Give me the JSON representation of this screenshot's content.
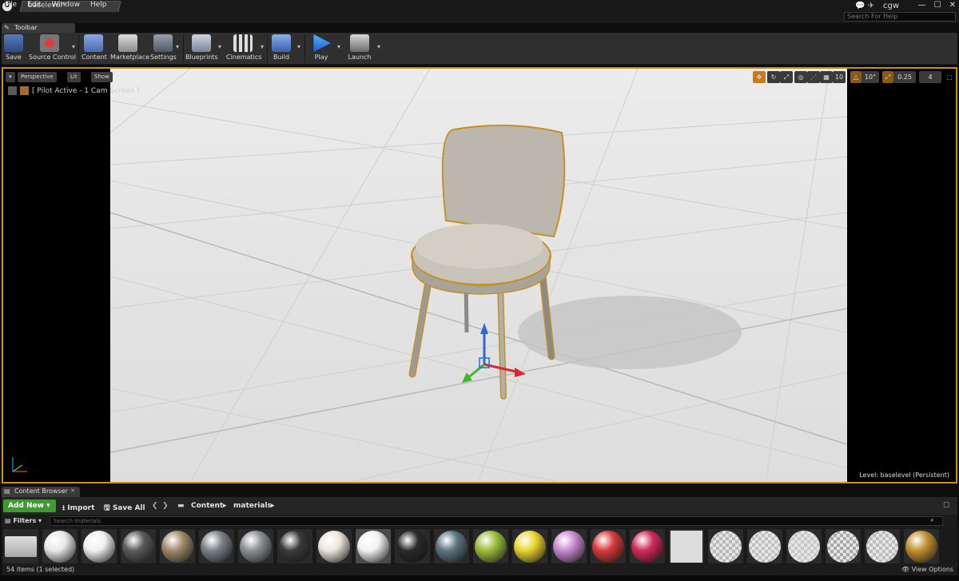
{
  "window": {
    "document_tab": "baselevel*",
    "user": "cgw",
    "search_help_placeholder": "Search For Help"
  },
  "menu": [
    "File",
    "Edit",
    "Window",
    "Help"
  ],
  "toolbar": {
    "tab_label": "Toolbar",
    "buttons": [
      {
        "label": "Save",
        "icon": "save-icon"
      },
      {
        "label": "Source Control",
        "icon": "source-control-icon"
      },
      {
        "label": "Content",
        "icon": "content-icon"
      },
      {
        "label": "Marketplace",
        "icon": "marketplace-icon"
      },
      {
        "label": "Settings",
        "icon": "settings-icon"
      },
      {
        "label": "Blueprints",
        "icon": "blueprints-icon"
      },
      {
        "label": "Cinematics",
        "icon": "cinematics-icon"
      },
      {
        "label": "Build",
        "icon": "build-icon"
      },
      {
        "label": "Play",
        "icon": "play-icon"
      },
      {
        "label": "Launch",
        "icon": "launch-icon"
      }
    ]
  },
  "viewport": {
    "perspective_label": "Perspective",
    "lit_label": "Lit",
    "show_label": "Show",
    "pilot_label": "[ Pilot Active - 1 Cam Screen ]",
    "grid_snap_value": "10",
    "rotation_snap_value": "10°",
    "scale_snap_value": "0.25",
    "camera_speed_value": "4",
    "level_label": "Level:",
    "level_value": "baselevel (Persistent)"
  },
  "content_browser": {
    "tab_label": "Content Browser",
    "add_new_label": "Add New",
    "import_label": "Import",
    "save_all_label": "Save All",
    "path": [
      "Content",
      "materials"
    ],
    "filters_label": "Filters",
    "search_placeholder": "Search materials",
    "status": "54 items (1 selected)",
    "view_options_label": "View Options",
    "assets": [
      {
        "type": "folder",
        "color": "#d0d0d0"
      },
      {
        "type": "material",
        "color": "#e8e8e8"
      },
      {
        "type": "material",
        "color": "#f0f0f0"
      },
      {
        "type": "material",
        "color": "#5a5a5a"
      },
      {
        "type": "material",
        "color": "#a08a6a"
      },
      {
        "type": "material",
        "color": "#7a8288"
      },
      {
        "type": "material",
        "color": "#8c9094"
      },
      {
        "type": "material",
        "color": "#3a3a3a"
      },
      {
        "type": "material",
        "color": "#ece6dc"
      },
      {
        "type": "material",
        "color": "#f2f2f2"
      },
      {
        "type": "material",
        "color": "#2a2a2a"
      },
      {
        "type": "material",
        "color": "#5e7480"
      },
      {
        "type": "material",
        "color": "#9cbc3a"
      },
      {
        "type": "material",
        "color": "#e8d630"
      },
      {
        "type": "material",
        "color": "#c88ad0"
      },
      {
        "type": "material",
        "color": "#d83a3a"
      },
      {
        "type": "material",
        "color": "#d02a5a"
      },
      {
        "type": "mesh",
        "color": "#dcdcdc"
      },
      {
        "type": "checker",
        "color": "#b8b8b8"
      },
      {
        "type": "checker",
        "color": "#c0c0c0"
      },
      {
        "type": "checker",
        "color": "#c8c8c8"
      },
      {
        "type": "checker",
        "color": "#a8a8a8"
      },
      {
        "type": "checker",
        "color": "#bcbcbc"
      },
      {
        "type": "material",
        "color": "#c09030"
      }
    ]
  },
  "colors": {
    "selection_outline": "#c8901e",
    "add_new_green": "#3f9a30"
  }
}
